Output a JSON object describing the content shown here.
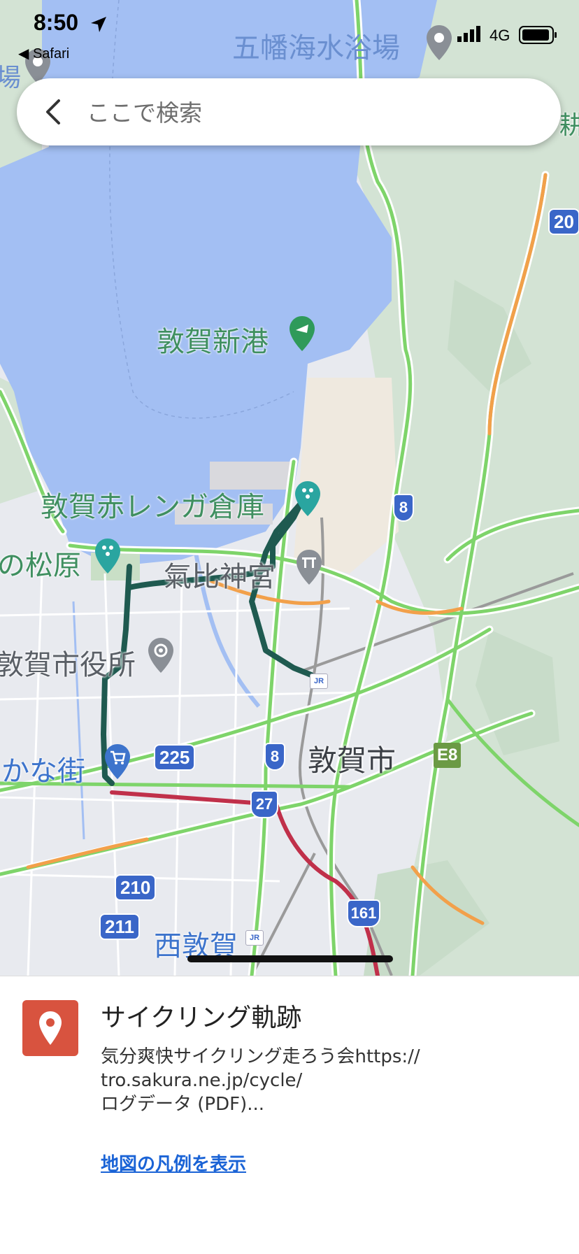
{
  "status_bar": {
    "time": "8:50",
    "back_app": "◀ Safari",
    "network": "4G",
    "icons": [
      "location-arrow-icon",
      "signal-icon",
      "battery-icon"
    ]
  },
  "search": {
    "placeholder": "ここで検索",
    "icon": "chevron-left-icon"
  },
  "map": {
    "places": {
      "beach": "五幡海水浴場",
      "left_top_edge": "場",
      "right_top_edge": "耕",
      "port": "敦賀新港",
      "warehouse": "敦賀赤レンガ倉庫",
      "pine": "の松原",
      "shrine": "氣比神宮",
      "city_hall": "敦賀市役所",
      "mall": "かな街",
      "city": "敦賀市",
      "station": "西敦賀"
    },
    "routes": {
      "r20": "20",
      "r8a": "8",
      "r8b": "8",
      "r225": "225",
      "r27": "27",
      "r210": "210",
      "r211": "211",
      "r161": "161",
      "e8": "E8"
    },
    "jr": "JR"
  },
  "sheet": {
    "title": "サイクリング軌跡",
    "description": [
      "気分爽快サイクリング走ろう会https://",
      "tro.sakura.ne.jp/cycle/",
      "ログデータ (PDF)..."
    ],
    "legend_link": "地図の凡例を表示",
    "icon": "map-pin-icon",
    "icon_color": "#d8533f"
  },
  "colors": {
    "water": "#a3bff3",
    "land": "#e9ebf0",
    "forest": "#d4e4d4",
    "traffic_green": "#7ed46a",
    "traffic_orange": "#f2a04a",
    "traffic_red": "#c0304a",
    "track": "#1f5a50"
  }
}
